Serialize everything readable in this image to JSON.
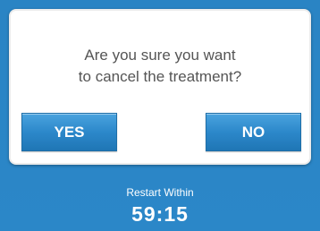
{
  "dialog": {
    "message_line1": "Are you sure you want",
    "message_line2": "to cancel the treatment?",
    "yes_label": "YES",
    "no_label": "NO"
  },
  "footer": {
    "restart_label": "Restart Within",
    "countdown": "59:15"
  },
  "colors": {
    "background": "#2b86c6",
    "button": "#2c88ca",
    "dialog": "#ffffff",
    "message_text": "#555555"
  }
}
